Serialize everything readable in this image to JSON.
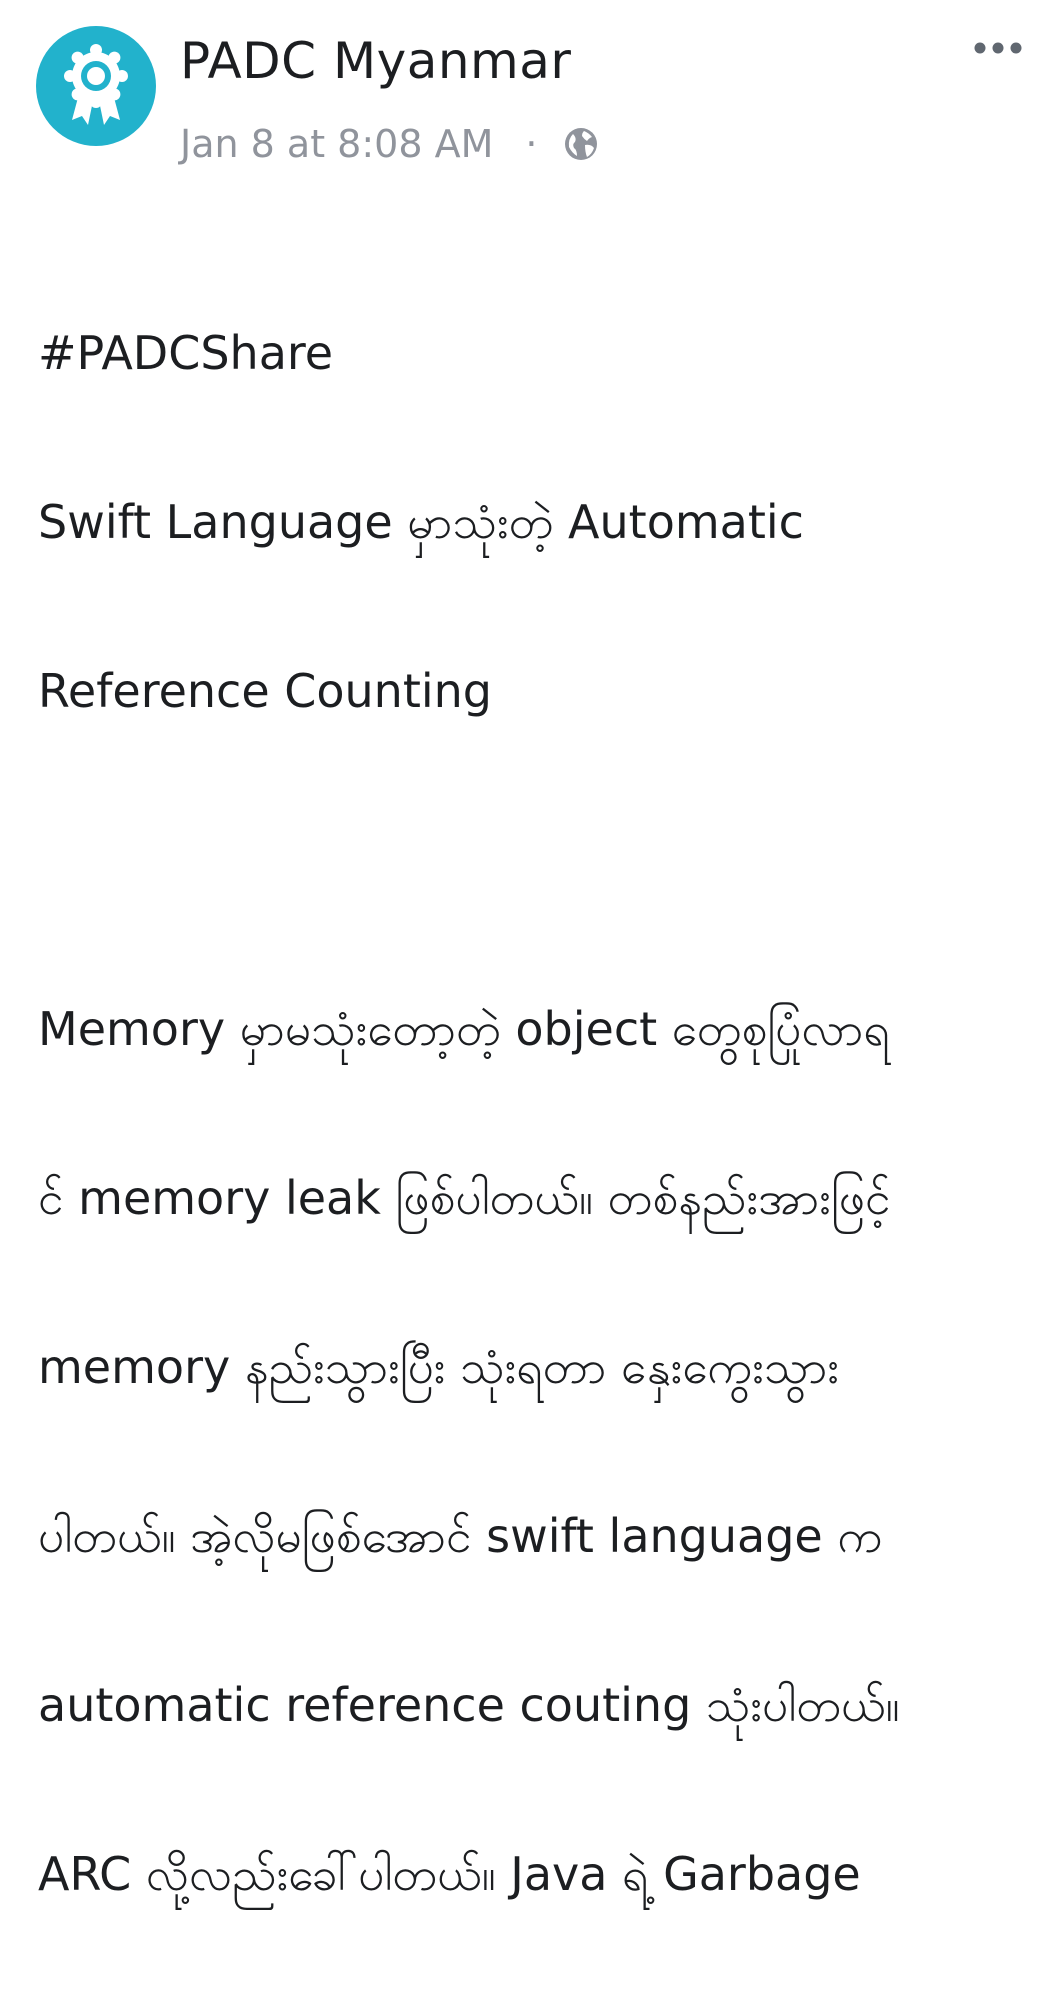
{
  "post": {
    "author": "PADC Myanmar",
    "timestamp": "Jan 8 at 8:08 AM",
    "separator": "·",
    "privacy_icon": "globe-icon",
    "more_icon": "more-options-icon",
    "avatar_icon": "award-ribbon-icon",
    "hashtag": "#PADCShare",
    "title_lines": [
      "Swift Language မှာသုံးတဲ့ Automatic",
      "Reference Counting"
    ],
    "body_lines": [
      "Memory မှာမသုံးတော့တဲ့ object တွေစုပြုံလာရ",
      "င် memory leak ဖြစ်ပါတယ်။ တစ်နည်းအားဖြင့်",
      "memory နည်းသွားပြီး သုံးရတာ နှေးကွေးသွား",
      "ပါတယ်။ အဲ့လိုမဖြစ်အောင် swift language က",
      "automatic reference couting သုံးပါတယ်။",
      "ARC လို့လည်းခေါ်ပါတယ်။ Java ရဲ့ Garbage"
    ]
  },
  "colors": {
    "avatar_bg": "#22b2cc",
    "text": "#1c1e21",
    "meta": "#90949c"
  }
}
